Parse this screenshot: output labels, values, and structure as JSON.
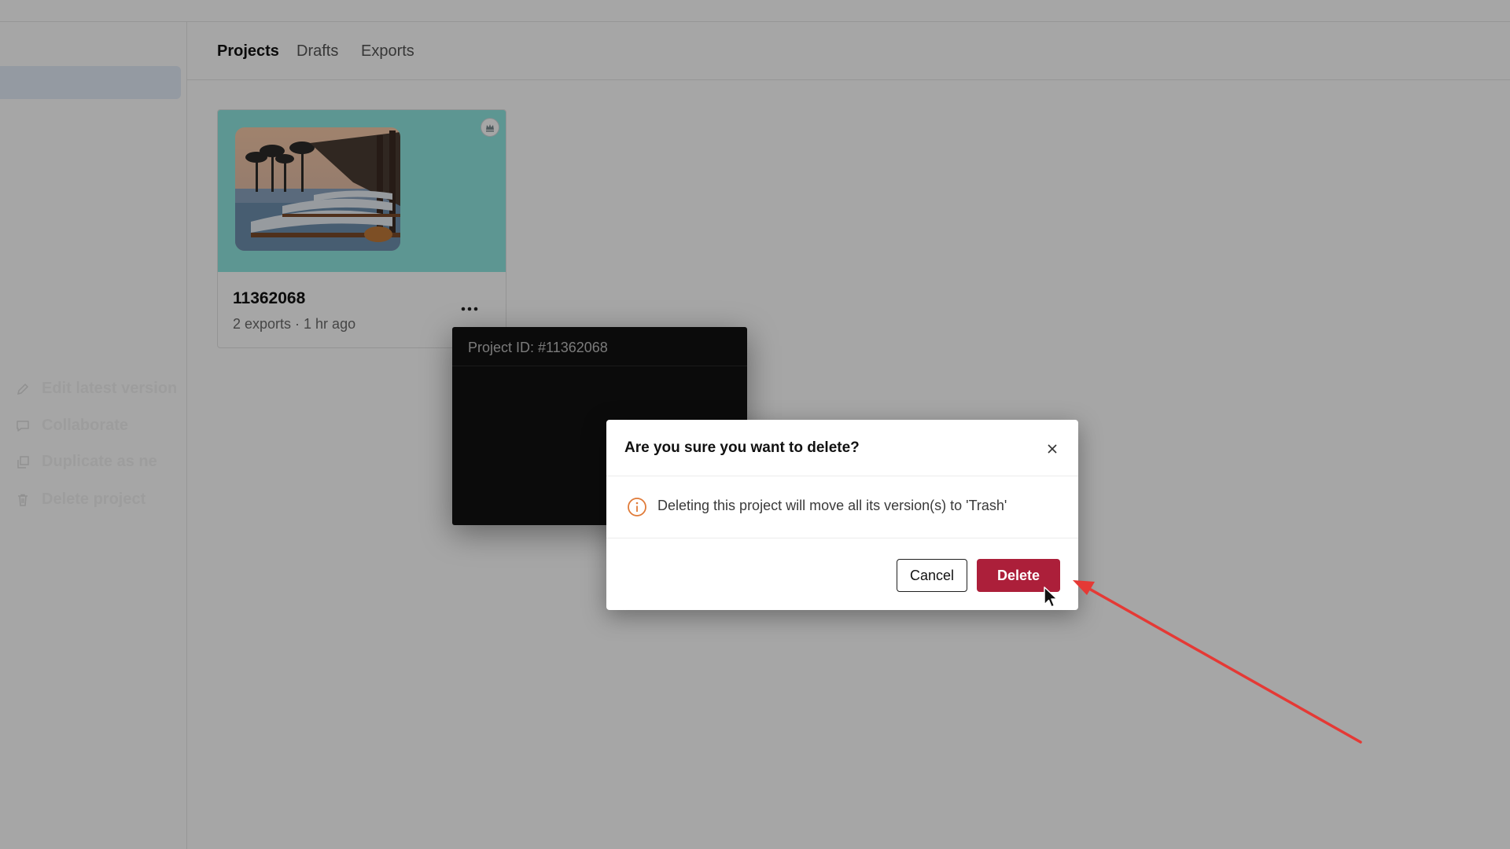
{
  "tabs": [
    {
      "label": "Projects",
      "active": true
    },
    {
      "label": "Drafts",
      "active": false
    },
    {
      "label": "Exports",
      "active": false
    }
  ],
  "project_card": {
    "title": "11362068",
    "meta": "2 exports · 1 hr ago",
    "thumbnail_bg": "#8fe7e0"
  },
  "context_menu": {
    "header": "Project ID: #11362068",
    "items": [
      {
        "label": "Edit latest version",
        "icon": "pencil-icon"
      },
      {
        "label": "Collaborate",
        "icon": "comment-icon"
      },
      {
        "label": "Duplicate as ne",
        "icon": "duplicate-icon"
      },
      {
        "label": "Delete project",
        "icon": "trash-icon"
      }
    ]
  },
  "dialog": {
    "title": "Are you sure you want to delete?",
    "message": "Deleting this project will move all its version(s) to 'Trash'",
    "cancel_label": "Cancel",
    "delete_label": "Delete",
    "accent_color": "#ac1f3a",
    "info_color": "#e07b39"
  },
  "annotation": {
    "color": "#e53935"
  }
}
